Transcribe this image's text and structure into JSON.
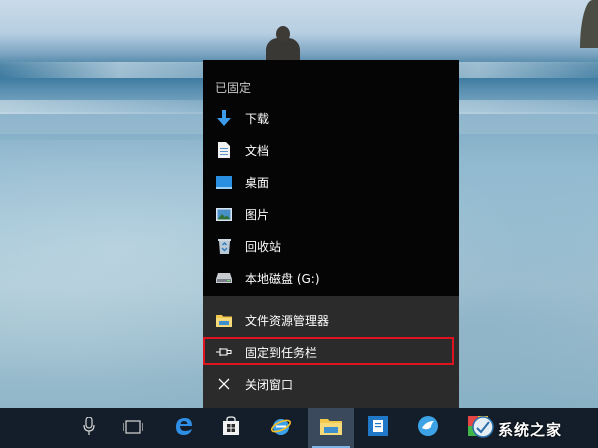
{
  "jump_list": {
    "section_title": "已固定",
    "pinned_items": [
      {
        "label": "下载",
        "icon": "download-arrow-icon"
      },
      {
        "label": "文档",
        "icon": "document-icon"
      },
      {
        "label": "桌面",
        "icon": "desktop-icon"
      },
      {
        "label": "图片",
        "icon": "pictures-icon"
      },
      {
        "label": "回收站",
        "icon": "recycle-bin-icon"
      },
      {
        "label": "本地磁盘 (G:)",
        "icon": "drive-icon"
      }
    ],
    "actions": [
      {
        "label": "文件资源管理器",
        "icon": "file-explorer-icon"
      },
      {
        "label": "固定到任务栏",
        "icon": "pin-icon",
        "highlighted": true
      },
      {
        "label": "关闭窗口",
        "icon": "close-icon"
      }
    ]
  },
  "taskbar": {
    "buttons": [
      {
        "name": "microphone",
        "icon": "microphone-icon"
      },
      {
        "name": "task-view",
        "icon": "task-view-icon"
      },
      {
        "name": "edge",
        "icon": "edge-icon"
      },
      {
        "name": "store",
        "icon": "store-icon"
      },
      {
        "name": "internet-explorer",
        "icon": "ie-icon"
      },
      {
        "name": "file-explorer",
        "icon": "file-explorer-icon",
        "active": true
      },
      {
        "name": "app-blue",
        "icon": "app-icon"
      },
      {
        "name": "bird-app",
        "icon": "bird-icon"
      },
      {
        "name": "paint-app",
        "icon": "paint-icon"
      }
    ]
  },
  "watermark": {
    "text": "系统之家"
  },
  "colors": {
    "highlight": "#e0141e",
    "taskbar": "#141e2a",
    "menu_dark": "#050505",
    "menu_actions": "#2b2b2b"
  }
}
